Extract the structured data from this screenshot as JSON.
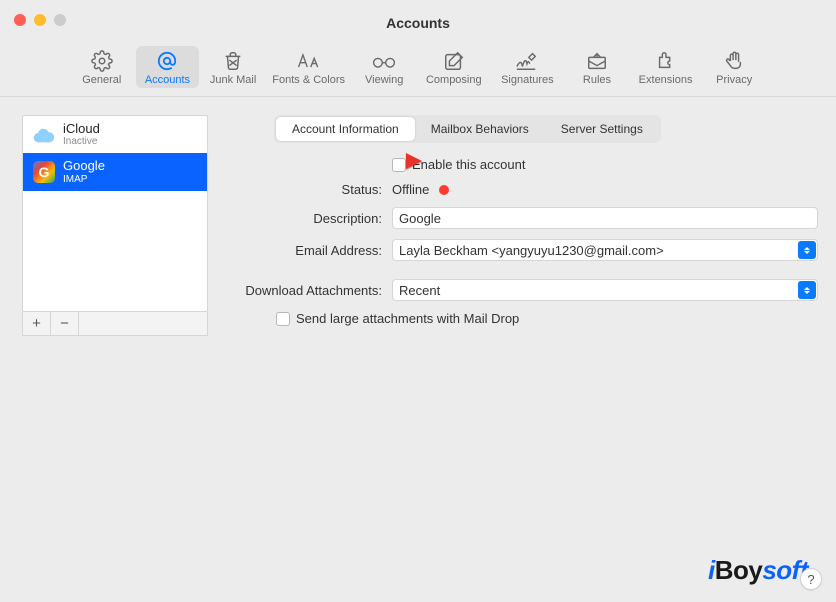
{
  "window": {
    "title": "Accounts"
  },
  "toolbar": [
    {
      "id": "general",
      "label": "General"
    },
    {
      "id": "accounts",
      "label": "Accounts"
    },
    {
      "id": "junk",
      "label": "Junk Mail"
    },
    {
      "id": "fonts",
      "label": "Fonts & Colors"
    },
    {
      "id": "viewing",
      "label": "Viewing"
    },
    {
      "id": "composing",
      "label": "Composing"
    },
    {
      "id": "signatures",
      "label": "Signatures"
    },
    {
      "id": "rules",
      "label": "Rules"
    },
    {
      "id": "extensions",
      "label": "Extensions"
    },
    {
      "id": "privacy",
      "label": "Privacy"
    }
  ],
  "toolbar_active": "accounts",
  "accounts": [
    {
      "name": "iCloud",
      "subtitle": "Inactive",
      "provider": "icloud"
    },
    {
      "name": "Google",
      "subtitle": "IMAP",
      "provider": "google"
    }
  ],
  "accounts_selected_index": 1,
  "sidebar_buttons": {
    "add": "+",
    "remove": "−"
  },
  "tabs": [
    {
      "id": "info",
      "label": "Account Information"
    },
    {
      "id": "mailbox",
      "label": "Mailbox Behaviors"
    },
    {
      "id": "server",
      "label": "Server Settings"
    }
  ],
  "tabs_active": "info",
  "form": {
    "enable_label": "Enable this account",
    "enable_checked": false,
    "status_label": "Status:",
    "status_value": "Offline",
    "description_label": "Description:",
    "description_value": "Google",
    "email_label": "Email Address:",
    "email_value": "Layla Beckham <yangyuyu1230@gmail.com>",
    "download_label": "Download Attachments:",
    "download_value": "Recent",
    "maildrop_label": "Send large attachments with Mail Drop",
    "maildrop_checked": false
  },
  "brand": {
    "i": "i",
    "boy": "Boy",
    "soft": "soft"
  },
  "help": "?"
}
